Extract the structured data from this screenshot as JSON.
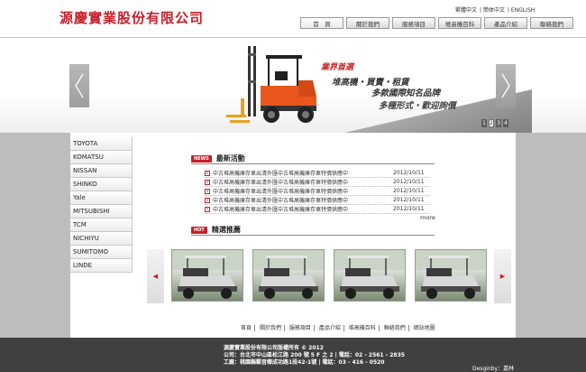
{
  "header": {
    "logo": "源慶實業股份有限公司",
    "languages": [
      "繁體中文",
      "簡体中文",
      "ENGLISH"
    ],
    "nav": [
      "首　頁",
      "關於我們",
      "服務項目",
      "堆高機百科",
      "產品介紹",
      "聯絡我們"
    ]
  },
  "banner": {
    "slogan": [
      "業界首選",
      "堆高機・買賣・租賃",
      "多款國際知名品牌",
      "多種形式・歡迎詢價"
    ],
    "pages": [
      "1",
      "2",
      "3",
      "4"
    ],
    "active_page": 2
  },
  "brands": [
    "TOYOTA",
    "KOMATSU",
    "NISSAN",
    "SHINKO",
    "Yale",
    "MITSUBISHI",
    "TCM",
    "NICHIYU",
    "SUMITOMO",
    "LINDE"
  ],
  "news": {
    "tag": "NEWS",
    "title": "最新活動",
    "items": [
      {
        "text": "中古堆高機庫存車出清外匯中古堆高機庫存車特價供應中",
        "date": "2012/10/11"
      },
      {
        "text": "中古堆高機庫存車出清外匯中古堆高機庫存車特價供應中",
        "date": "2012/10/11"
      },
      {
        "text": "中古堆高機庫存車出清外匯中古堆高機庫存車特價供應中",
        "date": "2012/10/11"
      },
      {
        "text": "中古堆高機庫存車出清外匯中古堆高機庫存車特價供應中",
        "date": "2012/10/11"
      },
      {
        "text": "中古堆高機庫存車出清外匯中古堆高機庫存車特價供應中",
        "date": "2012/10/11"
      }
    ],
    "more": "more"
  },
  "products": {
    "tag": "HOT",
    "title": "精選推薦",
    "count": 4
  },
  "footer": {
    "links": [
      "首頁",
      "關於我們",
      "服務項目",
      "產品介紹",
      "堆高機百科",
      "聯絡我們",
      "網站地圖"
    ],
    "copyright": "源慶實業股份有限公司版權所有 © 2012",
    "company_address": "公司：台北市中山區松江路 200 號 5 F 之 2 | 電話：02 - 2561 - 2835",
    "factory_address": "工廠：桃園縣觀音鄉成功路1段42-1號 | 電話：03 - 416 - 0520",
    "design": "Desginby：嘉林"
  },
  "colors": {
    "brand_red": "#c8202a",
    "footer_bg": "#404040",
    "band_gray": "#bdbdbd"
  }
}
